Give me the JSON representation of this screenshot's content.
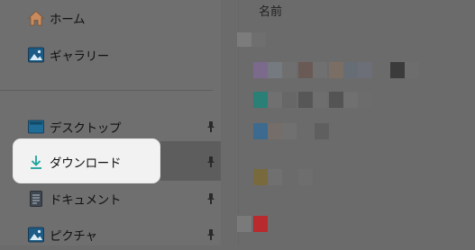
{
  "nav": {
    "items": [
      {
        "label": "ホーム",
        "icon": "home-icon",
        "pinned": false
      },
      {
        "label": "ギャラリー",
        "icon": "gallery-icon",
        "pinned": false
      },
      {
        "label": "デスクトップ",
        "icon": "desktop-icon",
        "pinned": true
      },
      {
        "label": "ダウンロード",
        "icon": "download-icon",
        "pinned": true,
        "highlighted": true
      },
      {
        "label": "ドキュメント",
        "icon": "documents-icon",
        "pinned": true
      },
      {
        "label": "ピクチャ",
        "icon": "pictures-icon",
        "pinned": true
      }
    ]
  },
  "content": {
    "column_header": "名前"
  },
  "colors": {
    "accent_download": "#1aa39a",
    "highlight_bg": "#f2f2f2"
  }
}
